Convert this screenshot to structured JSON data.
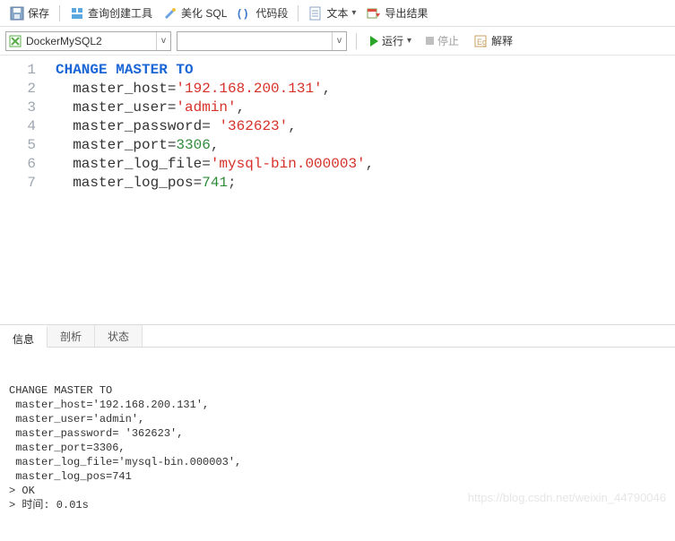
{
  "toolbar": {
    "save": "保存",
    "query_builder": "查询创建工具",
    "beautify_sql": "美化 SQL",
    "code_snippet": "代码段",
    "text": "文本",
    "export": "导出结果"
  },
  "connbar": {
    "connection": "DockerMySQL2",
    "database": "",
    "run": "运行",
    "stop": "停止",
    "explain": "解释"
  },
  "editor": {
    "lines": [
      "1",
      "2",
      "3",
      "4",
      "5",
      "6",
      "7"
    ],
    "tokens": [
      [
        {
          "t": "CHANGE MASTER TO",
          "c": "kw"
        }
      ],
      [
        {
          "t": "  master_host=",
          "c": ""
        },
        {
          "t": "'192.168.200.131'",
          "c": "str"
        },
        {
          "t": ",",
          "c": "punct"
        }
      ],
      [
        {
          "t": "  master_user=",
          "c": ""
        },
        {
          "t": "'admin'",
          "c": "str"
        },
        {
          "t": ",",
          "c": "punct"
        }
      ],
      [
        {
          "t": "  master_password= ",
          "c": ""
        },
        {
          "t": "'362623'",
          "c": "str"
        },
        {
          "t": ",",
          "c": "punct"
        }
      ],
      [
        {
          "t": "  master_port=",
          "c": ""
        },
        {
          "t": "3306",
          "c": "num"
        },
        {
          "t": ",",
          "c": "punct"
        }
      ],
      [
        {
          "t": "  master_log_file=",
          "c": ""
        },
        {
          "t": "'mysql-bin.000003'",
          "c": "str"
        },
        {
          "t": ",",
          "c": "punct"
        }
      ],
      [
        {
          "t": "  master_log_pos=",
          "c": ""
        },
        {
          "t": "741",
          "c": "num"
        },
        {
          "t": ";",
          "c": "punct"
        }
      ]
    ]
  },
  "tabs": {
    "info": "信息",
    "profile": "剖析",
    "status": "状态"
  },
  "output_lines": [
    "CHANGE MASTER TO",
    " master_host='192.168.200.131',",
    " master_user='admin',",
    " master_password= '362623',",
    " master_port=3306,",
    " master_log_file='mysql-bin.000003',",
    " master_log_pos=741",
    "> OK",
    "> 时间: 0.01s"
  ],
  "watermark": "https://blog.csdn.net/weixin_44790046"
}
